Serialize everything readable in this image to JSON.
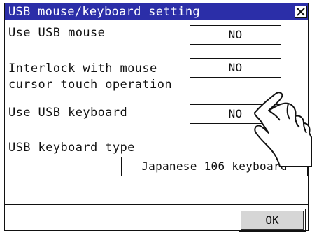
{
  "dialog": {
    "title": "USB mouse/keyboard setting",
    "close_glyph": "✕"
  },
  "settings": {
    "use_usb_mouse": {
      "label": "Use USB mouse",
      "value": "NO"
    },
    "interlock": {
      "label_line1": "Interlock with mouse",
      "label_line2": "cursor touch operation",
      "value": "NO"
    },
    "use_usb_keyboard": {
      "label": "Use USB keyboard",
      "value": "NO"
    },
    "keyboard_type": {
      "label": "USB keyboard type",
      "value": "Japanese 106 keyboard"
    }
  },
  "footer": {
    "ok_label": "OK"
  },
  "colors": {
    "titlebar": "#2b2ea8",
    "title_text": "#ffffff",
    "button_face": "#d6d6d6"
  },
  "icons": {
    "close": "close-icon",
    "pointer": "pointing-hand-icon"
  }
}
